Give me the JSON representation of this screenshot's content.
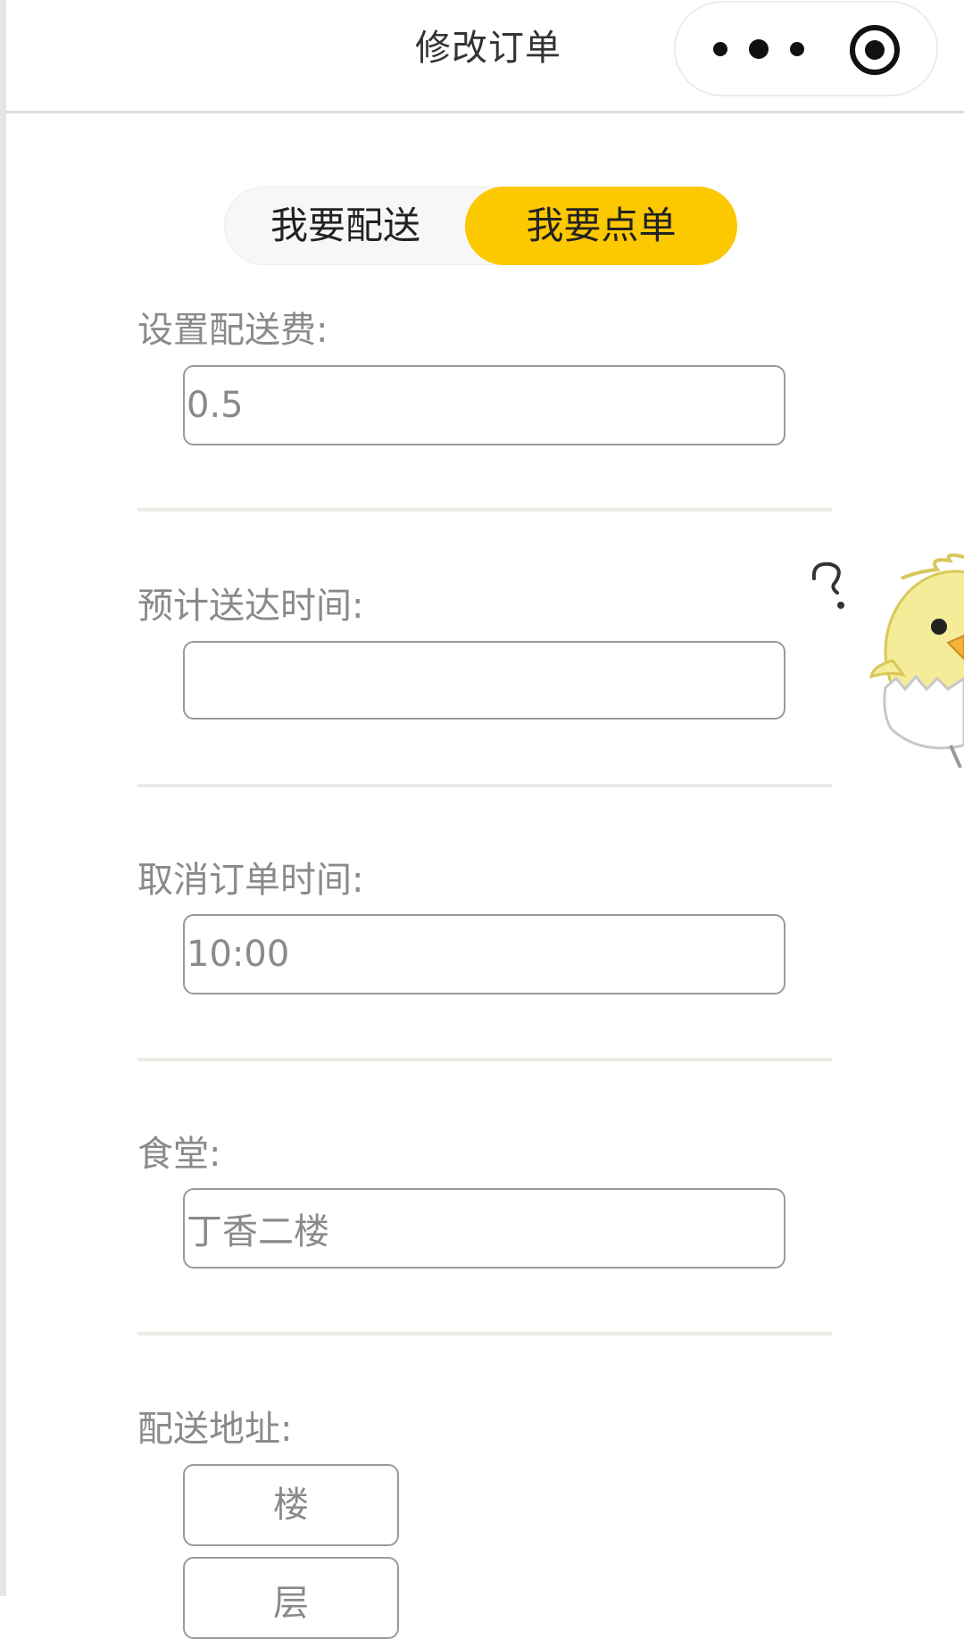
{
  "header": {
    "title": "修改订单",
    "more_icon": "more-dots-icon",
    "close_icon": "close-target-icon"
  },
  "tabs": [
    {
      "label": "我要配送",
      "active": false
    },
    {
      "label": "我要点单",
      "active": true
    }
  ],
  "form": {
    "delivery_fee": {
      "label": "设置配送费:",
      "value": "0.5"
    },
    "eta": {
      "label": "预计送达时间:",
      "value": ""
    },
    "cancel_time": {
      "label": "取消订单时间:",
      "value": "10:00"
    },
    "canteen": {
      "label": "食堂:",
      "value": "丁香二楼"
    },
    "address": {
      "label": "配送地址:",
      "building": "楼",
      "floor": "层"
    }
  },
  "colors": {
    "accent": "#fcc800",
    "label_text": "#8a8a8a",
    "divider": "#ecece7"
  },
  "decoration": {
    "mascot_icon": "confused-chick-icon"
  }
}
